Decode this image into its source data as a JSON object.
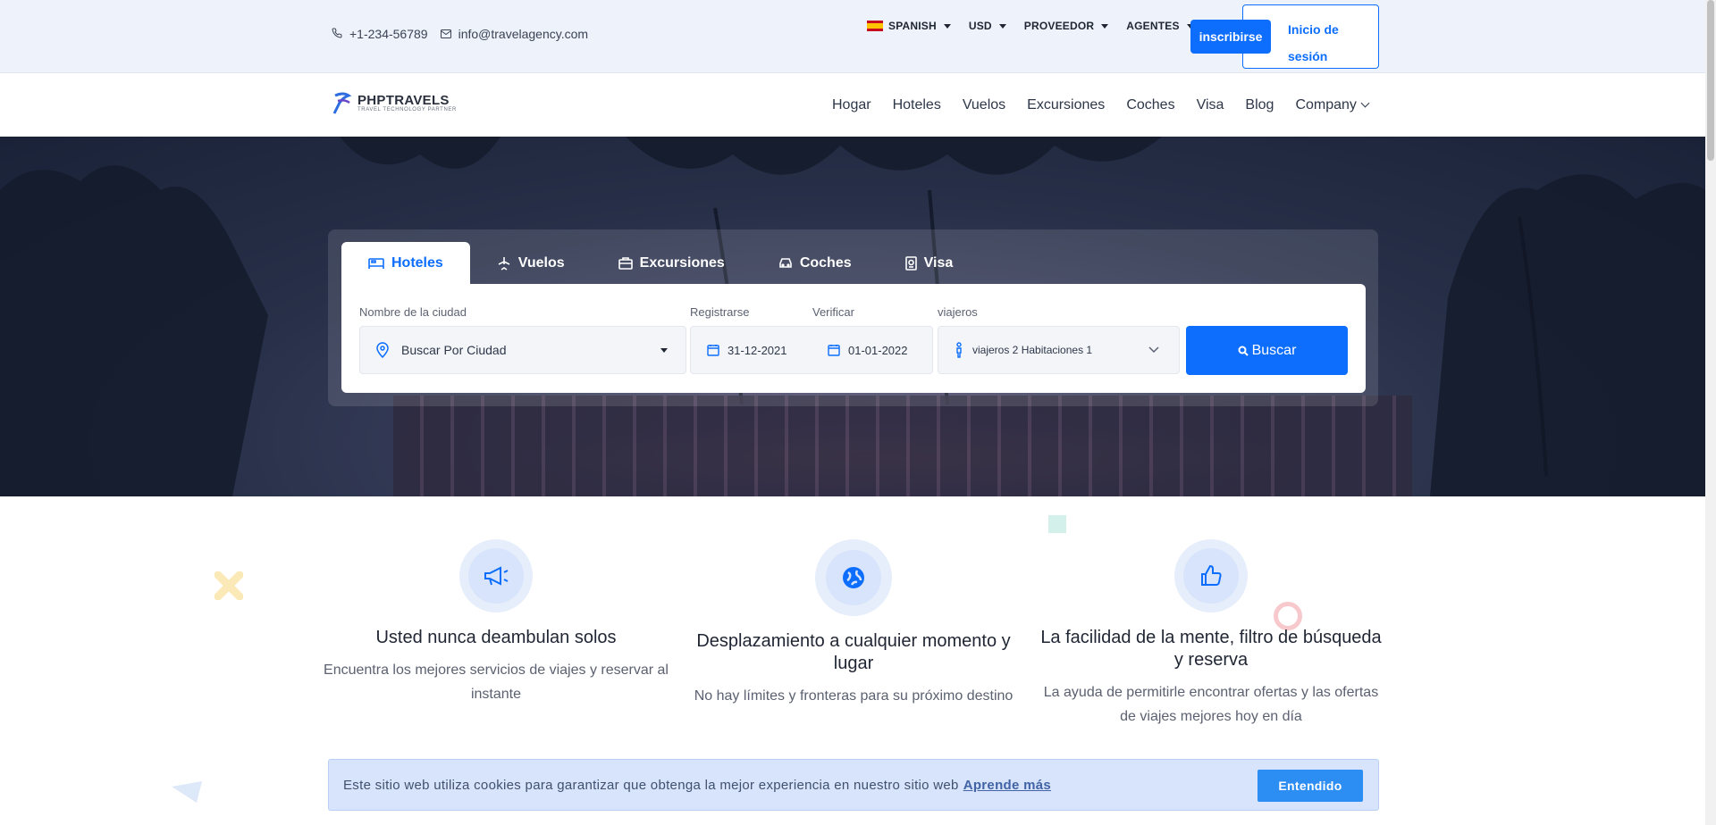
{
  "topbar": {
    "phone": "+1-234-56789",
    "email": "info@travelagency.com",
    "language": "SPANISH",
    "currency": "USD",
    "supplier": "PROVEEDOR",
    "agents": "AGENTES",
    "signup": "inscribirse",
    "login_line1": "Inicio de",
    "login_line2": "sesión"
  },
  "brand": {
    "name": "PHPTRAVELS",
    "tagline": "TRAVEL TECHNOLOGY PARTNER"
  },
  "nav": {
    "items": [
      "Hogar",
      "Hoteles",
      "Vuelos",
      "Excursiones",
      "Coches",
      "Visa",
      "Blog",
      "Company"
    ]
  },
  "search": {
    "tabs": [
      {
        "label": "Hoteles",
        "icon": "bed-icon"
      },
      {
        "label": "Vuelos",
        "icon": "plane-icon"
      },
      {
        "label": "Excursiones",
        "icon": "suitcase-icon"
      },
      {
        "label": "Coches",
        "icon": "car-icon"
      },
      {
        "label": "Visa",
        "icon": "passport-icon"
      }
    ],
    "city_label": "Nombre de la ciudad",
    "city_value": "Buscar Por Ciudad",
    "checkin_label": "Registrarse",
    "checkin_value": "31-12-2021",
    "checkout_label": "Verificar",
    "checkout_value": "01-01-2022",
    "travellers_label": "viajeros",
    "travellers_value": "viajeros 2 Habitaciones 1",
    "button": "Buscar"
  },
  "features": [
    {
      "title": "Usted nunca deambulan solos",
      "text": "Encuentra los mejores servicios de viajes y reservar al instante",
      "icon": "megaphone-icon"
    },
    {
      "title": "Desplazamiento a cualquier momento y lugar",
      "text": "No hay límites y fronteras para su próximo destino",
      "icon": "globe-icon"
    },
    {
      "title": "La facilidad de la mente, filtro de búsqueda y reserva",
      "text": "La ayuda de permitirle encontrar ofertas y las ofertas de viajes mejores hoy en día",
      "icon": "thumbs-up-icon"
    }
  ],
  "cookie": {
    "text": "Este sitio web utiliza cookies para garantizar que obtenga la mejor experiencia en nuestro sitio web",
    "link": "Aprende más",
    "button": "Entendido"
  },
  "colors": {
    "primary": "#0d6efd",
    "topbar_bg": "#eef2fa",
    "cookie_bg": "#d7e4fb"
  }
}
